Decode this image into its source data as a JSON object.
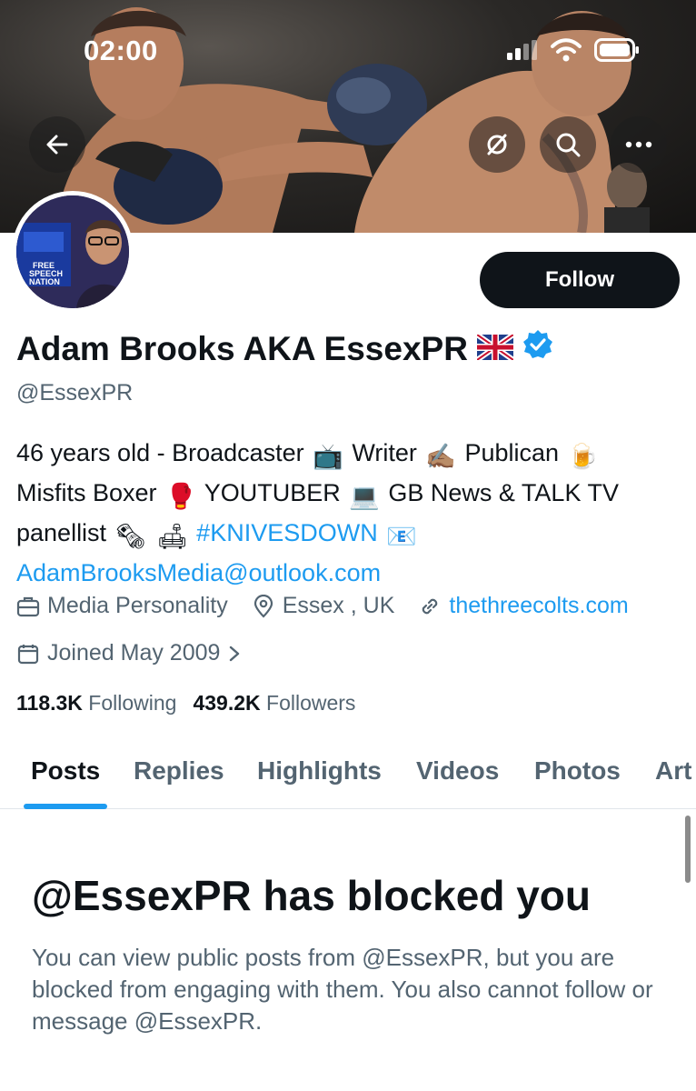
{
  "status_bar": {
    "time": "02:00"
  },
  "header": {
    "back_icon": "arrow-left-icon",
    "icons": [
      "eye-off-icon",
      "search-icon",
      "more-icon"
    ]
  },
  "profile": {
    "display_name": "Adam Brooks AKA EssexPR",
    "flag_emoji": "🇬🇧",
    "verified": true,
    "handle": "@EssexPR",
    "follow_label": "Follow",
    "avatar_text": "FREE SPEECH NATION",
    "bio": {
      "line1": "46 years old - Broadcaster",
      "emoji_tv": "📺",
      "writer": "Writer",
      "emoji_writing": "✍🏽",
      "publican": "Publican",
      "emoji_beer": "🍺",
      "line2_a": "Misfits Boxer",
      "emoji_glove": "🥊",
      "youtuber": "YOUTUBER",
      "emoji_laptop": "💻",
      "line2_b": "GB News & TALK TV",
      "line3_a": "panellist",
      "emoji_news": "🗞",
      "emoji_couch": "🛋",
      "hashtag": "#KNIVESDOWN",
      "emoji_mail": "📧",
      "email": "AdamBrooksMedia@outlook.com"
    },
    "category": "Media Personality",
    "location": "Essex , UK",
    "website": "thethreecolts.com",
    "joined": "Joined May 2009",
    "following_count": "118.3K",
    "following_label": "Following",
    "followers_count": "439.2K",
    "followers_label": "Followers"
  },
  "tabs": [
    {
      "label": "Posts",
      "active": true
    },
    {
      "label": "Replies"
    },
    {
      "label": "Highlights"
    },
    {
      "label": "Videos"
    },
    {
      "label": "Photos"
    },
    {
      "label": "Art"
    }
  ],
  "blocked": {
    "title": "@EssexPR has blocked you",
    "body": "You can view public posts from @EssexPR, but you are blocked from engaging with them. You also cannot follow or message @EssexPR."
  },
  "colors": {
    "accent": "#1d9bf0",
    "text_primary": "#0f1419",
    "text_secondary": "#536471",
    "button_dark": "#0f1419"
  }
}
